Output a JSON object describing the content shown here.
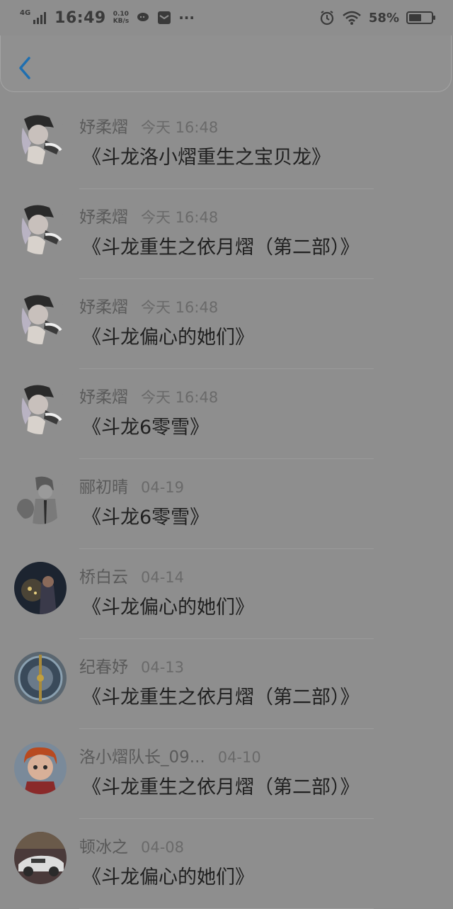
{
  "status_bar": {
    "network": "4G",
    "time": "16:49",
    "speed_value": "0.10",
    "speed_unit": "KB/s",
    "more": "···",
    "battery_pct": "58%",
    "battery_level": 0.58
  },
  "header": {
    "back_icon": "chevron-left-icon"
  },
  "messages": [
    {
      "name": "妤柔熠",
      "time": "今天 16:48",
      "title": "《斗龙洛小熠重生之宝贝龙》"
    },
    {
      "name": "妤柔熠",
      "time": "今天 16:48",
      "title": "《斗龙重生之依月熠（第二部）》"
    },
    {
      "name": "妤柔熠",
      "time": "今天 16:48",
      "title": "《斗龙偏心的她们》"
    },
    {
      "name": "妤柔熠",
      "time": "今天 16:48",
      "title": "《斗龙6零雪》"
    },
    {
      "name": "郦初晴",
      "time": "04-19",
      "title": "《斗龙6零雪》"
    },
    {
      "name": "桥白云",
      "time": "04-14",
      "title": "《斗龙偏心的她们》"
    },
    {
      "name": "纪春妤",
      "time": "04-13",
      "title": "《斗龙重生之依月熠（第二部）》"
    },
    {
      "name": "洛小熠队长_09...",
      "time": "04-10",
      "title": "《斗龙重生之依月熠（第二部）》"
    },
    {
      "name": "顿冰之",
      "time": "04-08",
      "title": "《斗龙偏心的她们》"
    }
  ]
}
